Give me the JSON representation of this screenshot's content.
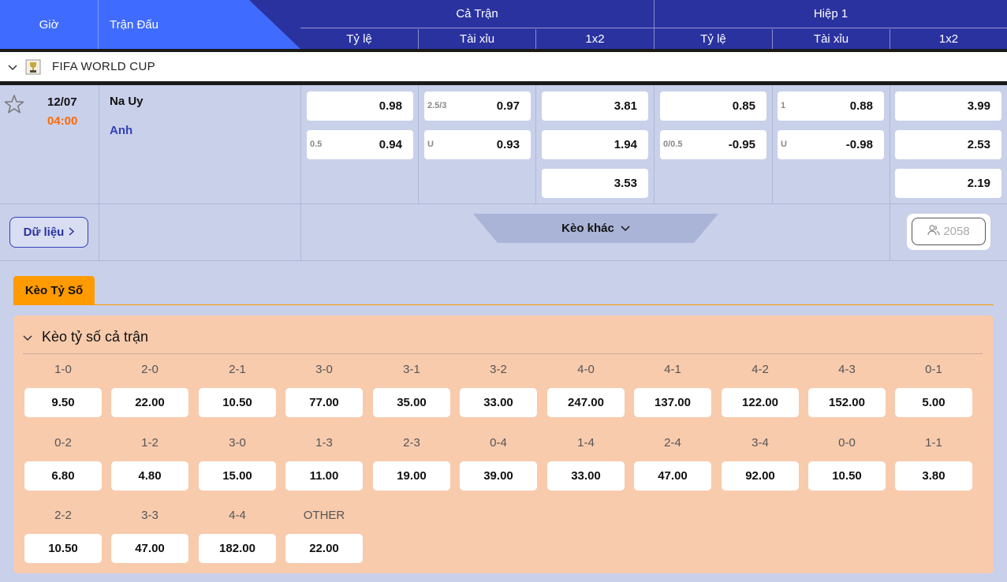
{
  "header": {
    "gio": "Giờ",
    "tran_dau": "Trận Đấu",
    "full_match": "Cả Trận",
    "half": "Hiệp 1",
    "sub": [
      "Tỷ lệ",
      "Tài xỉu",
      "1x2",
      "Tỷ lệ",
      "Tài xỉu",
      "1x2"
    ]
  },
  "league": {
    "name": "FIFA WORLD CUP"
  },
  "match": {
    "date": "12/07",
    "time": "04:00",
    "home": "Na Uy",
    "away": "Anh",
    "odds": {
      "full_hdp": [
        {
          "h": "",
          "v": "0.98"
        },
        {
          "h": "0.5",
          "v": "0.94"
        }
      ],
      "full_ou": [
        {
          "h": "2.5/3",
          "v": "0.97"
        },
        {
          "h": "U",
          "v": "0.93"
        }
      ],
      "full_1x2": [
        "3.81",
        "1.94",
        "3.53"
      ],
      "half_hdp": [
        {
          "h": "",
          "v": "0.85"
        },
        {
          "h": "0/0.5",
          "v": "-0.95"
        }
      ],
      "half_ou": [
        {
          "h": "1",
          "v": "0.88"
        },
        {
          "h": "U",
          "v": "-0.98"
        }
      ],
      "half_1x2": [
        "3.99",
        "2.53",
        "2.19"
      ]
    },
    "data_button": "Dữ liệu",
    "more_bets": "Kèo khác",
    "viewers": "2058"
  },
  "correct_score": {
    "tab": "Kèo Tỷ Số",
    "title": "Kèo tỷ số cả trận",
    "rows": [
      [
        {
          "s": "1-0",
          "o": "9.50"
        },
        {
          "s": "2-0",
          "o": "22.00"
        },
        {
          "s": "2-1",
          "o": "10.50"
        },
        {
          "s": "3-0",
          "o": "77.00"
        },
        {
          "s": "3-1",
          "o": "35.00"
        },
        {
          "s": "3-2",
          "o": "33.00"
        },
        {
          "s": "4-0",
          "o": "247.00"
        },
        {
          "s": "4-1",
          "o": "137.00"
        },
        {
          "s": "4-2",
          "o": "122.00"
        },
        {
          "s": "4-3",
          "o": "152.00"
        },
        {
          "s": "0-1",
          "o": "5.00"
        }
      ],
      [
        {
          "s": "0-2",
          "o": "6.80"
        },
        {
          "s": "1-2",
          "o": "4.80"
        },
        {
          "s": "3-0",
          "o": "15.00"
        },
        {
          "s": "1-3",
          "o": "11.00"
        },
        {
          "s": "2-3",
          "o": "19.00"
        },
        {
          "s": "0-4",
          "o": "39.00"
        },
        {
          "s": "1-4",
          "o": "33.00"
        },
        {
          "s": "2-4",
          "o": "47.00"
        },
        {
          "s": "3-4",
          "o": "92.00"
        },
        {
          "s": "0-0",
          "o": "10.50"
        },
        {
          "s": "1-1",
          "o": "3.80"
        }
      ],
      [
        {
          "s": "2-2",
          "o": "10.50"
        },
        {
          "s": "3-3",
          "o": "47.00"
        },
        {
          "s": "4-4",
          "o": "182.00"
        },
        {
          "s": "OTHER",
          "o": "22.00"
        }
      ]
    ]
  },
  "colors": {
    "header_dark": "#2a32a0",
    "header_light": "#3f6bff",
    "accent_orange": "#ff9a00",
    "time_orange": "#ff6a00",
    "panel_peach": "#f8cbad"
  }
}
